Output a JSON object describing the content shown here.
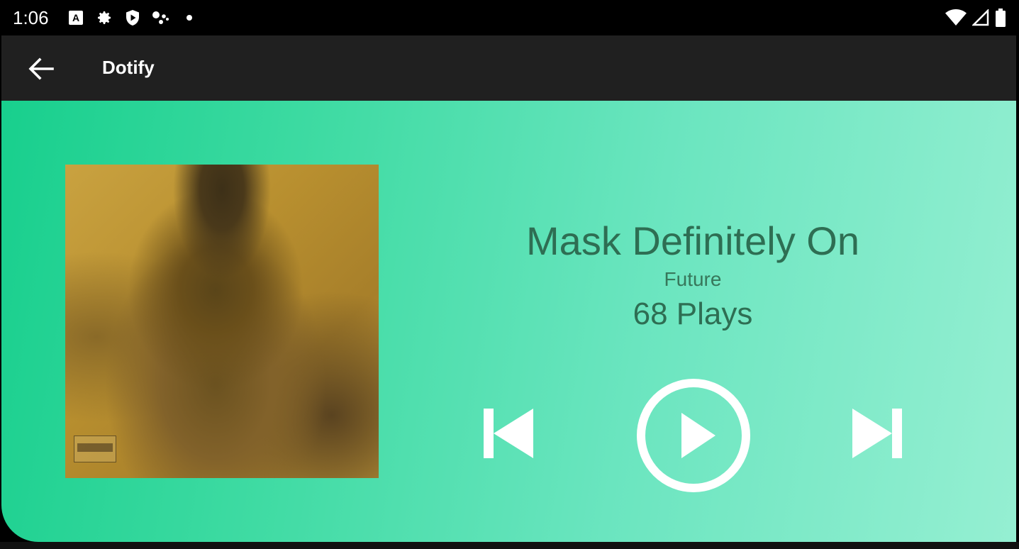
{
  "status_bar": {
    "time": "1:06",
    "left_icons": [
      "a-badge-icon",
      "settings-gear-icon",
      "shield-play-icon",
      "assistant-dots-icon",
      "dot-icon"
    ],
    "right_icons": [
      "wifi-icon",
      "cell-signal-icon",
      "battery-icon"
    ]
  },
  "app_bar": {
    "title": "Dotify",
    "back_icon": "arrow-left-icon"
  },
  "player": {
    "song_title": "Mask Definitely On",
    "artist": "Future",
    "plays": "68 Plays",
    "controls": [
      "skip-previous-icon",
      "play-circle-icon",
      "skip-next-icon"
    ]
  },
  "colors": {
    "app_bar_bg": "#202020",
    "gradient_start": "#18cf8d",
    "gradient_end": "#95efd2",
    "text_primary": "#2e6e53",
    "control_color": "#ffffff"
  }
}
